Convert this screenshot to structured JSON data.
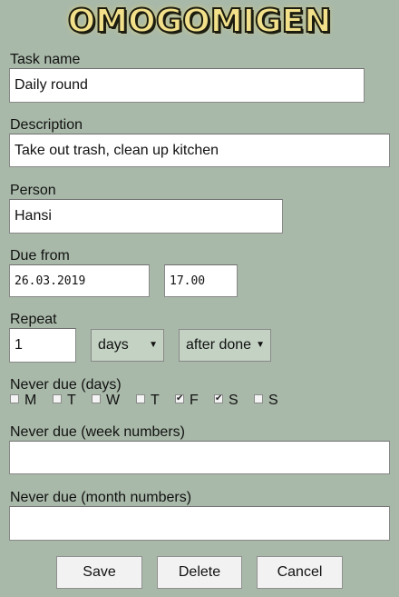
{
  "app": {
    "logo": "OMOGOMIGEN"
  },
  "form": {
    "task_name_label": "Task name",
    "task_name_value": "Daily round",
    "description_label": "Description",
    "description_value": "Take out trash, clean up kitchen",
    "person_label": "Person",
    "person_value": "Hansi",
    "due_from_label": "Due from",
    "due_date_value": "26.03.2019",
    "due_time_value": "17.00",
    "repeat_label": "Repeat",
    "repeat_count_value": "1",
    "repeat_unit_selected": "days",
    "repeat_mode_selected": "after done",
    "never_due_days_label": "Never due (days)",
    "days": [
      {
        "label": "M",
        "checked": false
      },
      {
        "label": "T",
        "checked": false
      },
      {
        "label": "W",
        "checked": false
      },
      {
        "label": "T",
        "checked": false
      },
      {
        "label": "F",
        "checked": true
      },
      {
        "label": "S",
        "checked": true
      },
      {
        "label": "S",
        "checked": false
      }
    ],
    "never_due_weeks_label": "Never due (week numbers)",
    "never_due_weeks_value": "",
    "never_due_months_label": "Never due (month numbers)",
    "never_due_months_value": ""
  },
  "buttons": {
    "save": "Save",
    "delete": "Delete",
    "cancel": "Cancel"
  },
  "icons": {
    "checkmark": "✔",
    "dropdown_caret": "▼"
  }
}
